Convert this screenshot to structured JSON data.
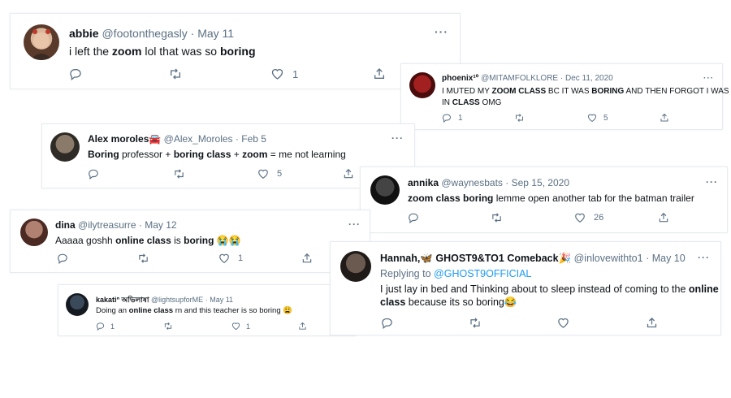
{
  "tweets": {
    "abbie": {
      "name": "abbie",
      "handle": "@footonthegasly",
      "sep": "·",
      "date": "May 11",
      "body": [
        "i left the ",
        "zoom",
        " lol that was so ",
        "boring"
      ],
      "likes": "1",
      "more": "···"
    },
    "phoenix": {
      "name": "phoenix¹º",
      "handle": "@MITAMFOLKLORE",
      "sep": "·",
      "date": "Dec 11, 2020",
      "line1": [
        "I MUTED MY ",
        "ZOOM CLASS",
        " BC IT WAS ",
        "BORING",
        " AND THEN FORGOT I WAS"
      ],
      "line2": [
        "IN ",
        "CLASS",
        " OMG"
      ],
      "replies": "1",
      "likes": "5",
      "more": "···"
    },
    "alex": {
      "name": "Alex moroles🚘",
      "handle": "@Alex_Moroles",
      "sep": "·",
      "date": "Feb 5",
      "body": [
        "Boring",
        " professor + ",
        "boring class",
        " + ",
        "zoom",
        " = me not learning"
      ],
      "likes": "5",
      "more": "···"
    },
    "annika": {
      "name": "annika",
      "handle": "@waynesbats",
      "sep": "·",
      "date": "Sep 15, 2020",
      "body": [
        "zoom class boring",
        " lemme open another tab for the batman trailer"
      ],
      "likes": "26",
      "more": "···"
    },
    "dina": {
      "name": "dina",
      "handle": "@ilytreasurre",
      "sep": "·",
      "date": "May 12",
      "body": [
        "Aaaaa goshh ",
        "online class",
        " is ",
        "boring",
        " 😭😭"
      ],
      "likes": "1",
      "more": "···"
    },
    "hannah": {
      "name": "Hannah,🦋 GHOST9&TO1 Comeback🎉",
      "handle": "@inlovewithto1",
      "sep": "·",
      "date": "May 10",
      "replying": "Replying to",
      "replying_to": "@GHOST9OFFICIAL",
      "line1": [
        "I just lay in bed and Thinking about to sleep instead of coming to the ",
        "online"
      ],
      "line2": [
        "class",
        " because its so boring😂"
      ],
      "more": "···"
    },
    "kakati": {
      "name": "kakatiᐢ অভিলাষা",
      "handle": "@lightsupforME",
      "sep": "·",
      "date": "May 11",
      "body": [
        "Doing an ",
        "online class",
        " rn and this teacher is so boring 😩"
      ],
      "replies": "1",
      "likes": "1",
      "more": "···"
    }
  },
  "icons": [
    "reply-icon",
    "retweet-icon",
    "like-icon",
    "share-icon",
    "more-icon"
  ]
}
